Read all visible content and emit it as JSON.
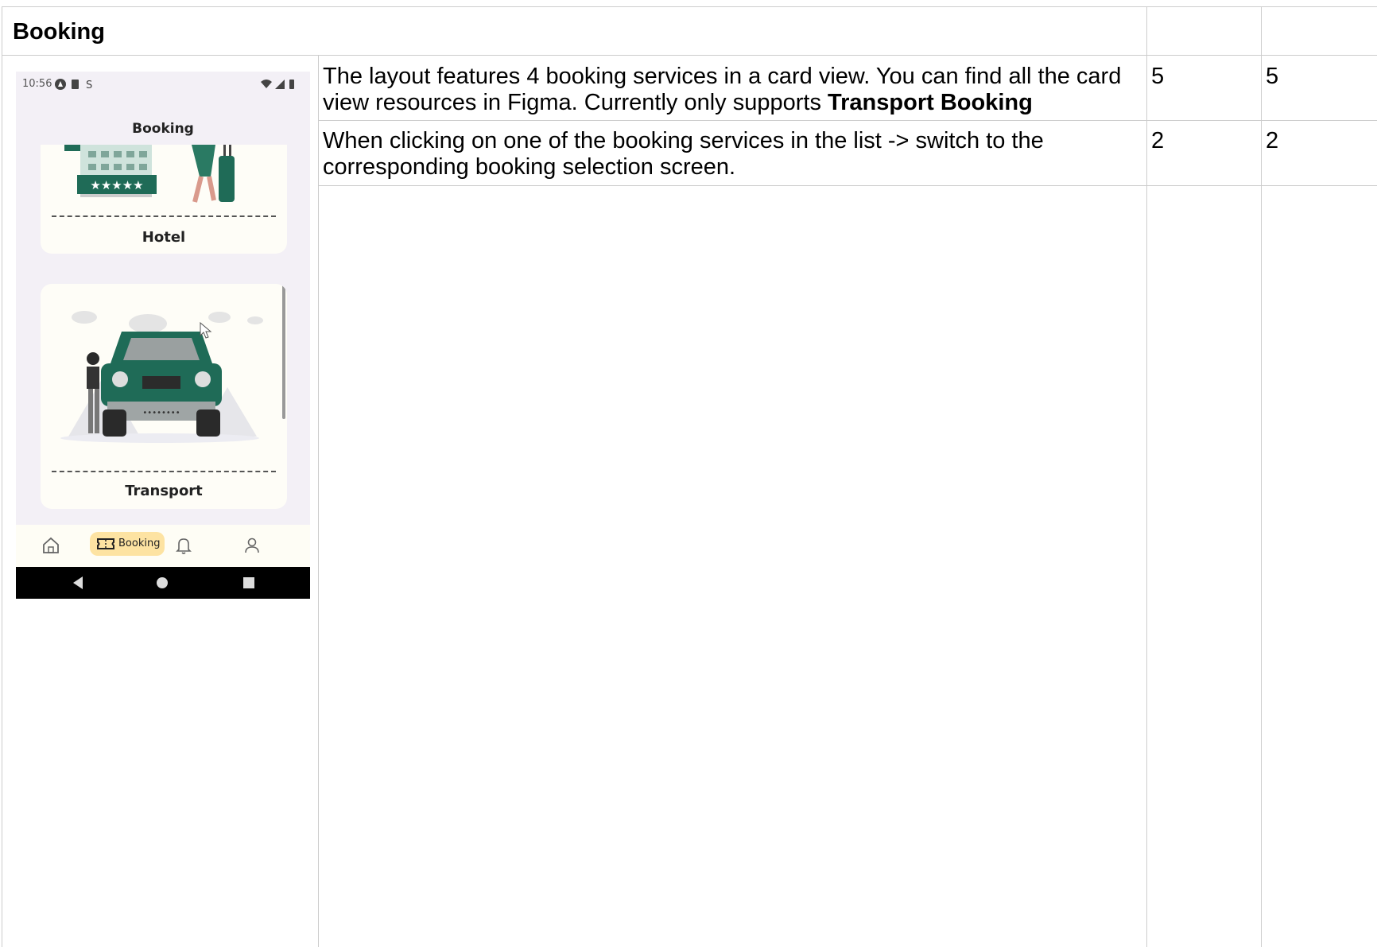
{
  "table": {
    "heading": "Booking",
    "rows": [
      {
        "description_prefix": "The layout features 4 booking services in a card view. You can find all the card view resources in Figma. Currently only supports ",
        "description_bold": "Transport Booking",
        "col3": "5",
        "col4": "5"
      },
      {
        "description": "When clicking on one of the booking services in the list -> switch to the corresponding booking selection screen.",
        "col3": "2",
        "col4": "2"
      }
    ]
  },
  "phone": {
    "status_time": "10:56",
    "screen_title": "Booking",
    "cards": [
      {
        "label": "Hotel"
      },
      {
        "label": "Transport"
      }
    ],
    "nav": {
      "active_label": "Booking",
      "items": [
        "home-icon",
        "ticket-icon",
        "bell-icon",
        "user-icon"
      ]
    },
    "colors": {
      "accent_green": "#1f6b57",
      "active_pill": "#fde3a2",
      "screen_bg": "#f3f0f6"
    }
  }
}
